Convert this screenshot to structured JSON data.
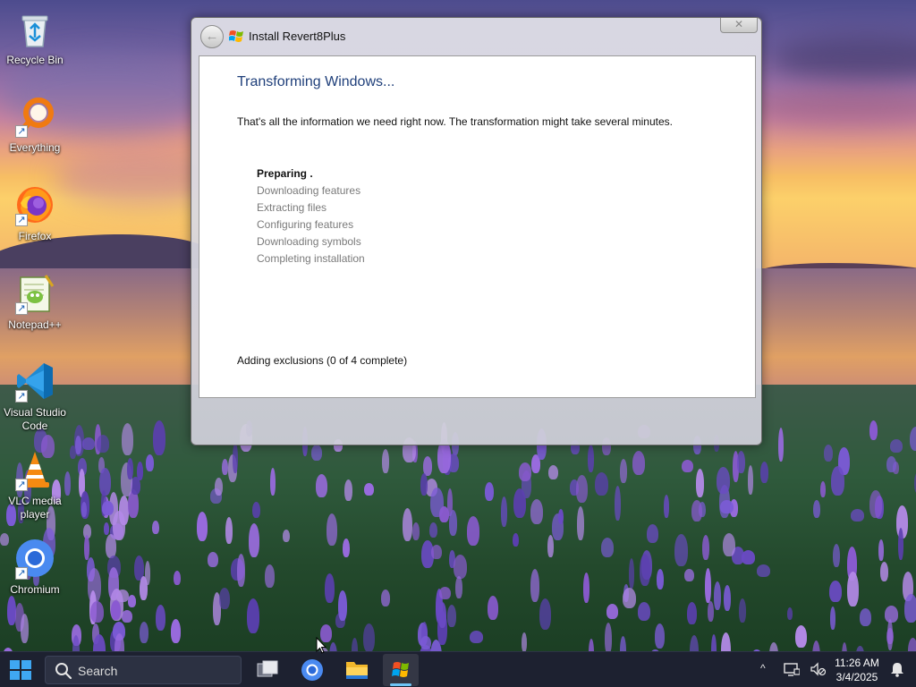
{
  "desktop": {
    "icons": [
      {
        "label": "Recycle Bin",
        "icon": "recycle-bin-icon"
      },
      {
        "label": "Everything",
        "icon": "everything-search-icon"
      },
      {
        "label": "Firefox",
        "icon": "firefox-icon"
      },
      {
        "label": "Notepad++",
        "icon": "notepad-plus-plus-icon"
      },
      {
        "label": "Visual Studio Code",
        "icon": "vscode-icon"
      },
      {
        "label": "VLC media player",
        "icon": "vlc-icon"
      },
      {
        "label": "Chromium",
        "icon": "chromium-icon"
      }
    ]
  },
  "window": {
    "title": "Install Revert8Plus",
    "back_icon": "back-arrow-icon",
    "close_icon": "close-icon",
    "heading": "Transforming Windows...",
    "description": "That's all the information we need right now. The transformation might take several minutes.",
    "steps": [
      {
        "label": "Preparing .",
        "active": true
      },
      {
        "label": "Downloading features",
        "active": false
      },
      {
        "label": "Extracting files",
        "active": false
      },
      {
        "label": "Configuring features",
        "active": false
      },
      {
        "label": "Downloading symbols",
        "active": false
      },
      {
        "label": "Completing installation",
        "active": false
      }
    ],
    "status": "Adding exclusions (0 of 4 complete)"
  },
  "taskbar": {
    "search_label": "Search",
    "apps": [
      {
        "name": "task-view",
        "icon": "task-view-icon",
        "active": false
      },
      {
        "name": "chromium",
        "icon": "chromium-icon",
        "active": false
      },
      {
        "name": "file-explorer",
        "icon": "folder-icon",
        "active": false
      },
      {
        "name": "installer",
        "icon": "windows-flag-icon",
        "active": true
      }
    ],
    "tray": {
      "chevron": "^",
      "time": "11:26 AM",
      "date": "3/4/2025"
    }
  },
  "colors": {
    "heading": "#1f3f7a",
    "taskbar": "#1d2130",
    "active_indicator": "#6fc5f6"
  }
}
